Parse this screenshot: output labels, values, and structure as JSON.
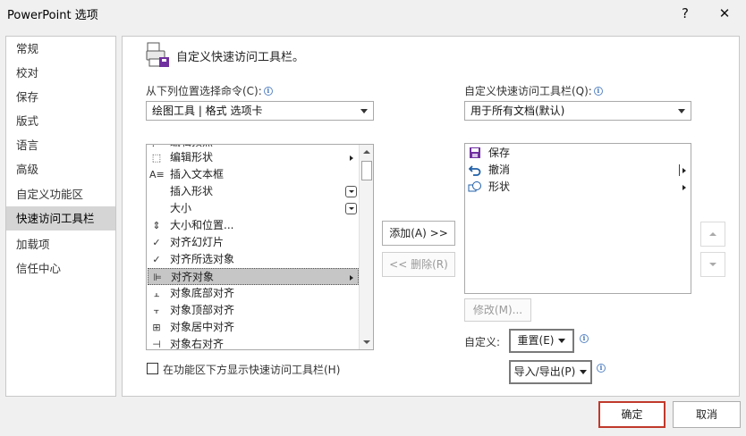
{
  "window": {
    "title": "PowerPoint 选项",
    "help_glyph": "?",
    "close_glyph": "✕"
  },
  "nav": {
    "items": [
      {
        "label": "常规"
      },
      {
        "label": "校对"
      },
      {
        "label": "保存"
      },
      {
        "label": "版式"
      },
      {
        "label": "语言"
      },
      {
        "label": "高级"
      },
      {
        "label": "自定义功能区"
      },
      {
        "label": "快速访问工具栏",
        "active": true
      },
      {
        "label": "加载项"
      },
      {
        "label": "信任中心"
      }
    ]
  },
  "header": {
    "title": "自定义快速访问工具栏。",
    "icon": "toolbar-customize-icon"
  },
  "left": {
    "label": "从下列位置选择命令(C):",
    "info_glyph": "i",
    "combo_value": "绘图工具 | 格式 选项卡",
    "commands": [
      {
        "label": "编辑顶点",
        "icon": "edit-points-icon",
        "glyph": "⋰"
      },
      {
        "label": "编辑形状",
        "icon": "edit-shape-icon",
        "glyph": "⬚",
        "submenu": true
      },
      {
        "label": "插入文本框",
        "icon": "text-box-icon",
        "glyph": "A≡"
      },
      {
        "label": "插入形状",
        "icon": "",
        "glyph": "",
        "dropdown": true
      },
      {
        "label": "大小",
        "icon": "",
        "glyph": "",
        "dropdown": true
      },
      {
        "label": "大小和位置...",
        "icon": "size-position-icon",
        "glyph": "⇕"
      },
      {
        "label": "对齐幻灯片",
        "icon": "check-icon",
        "glyph": "✓"
      },
      {
        "label": "对齐所选对象",
        "icon": "check-icon",
        "glyph": "✓"
      },
      {
        "label": "对齐对象",
        "icon": "align-icon",
        "glyph": "⊫",
        "submenu": true,
        "selected": true
      },
      {
        "label": "对象底部对齐",
        "icon": "align-bottom-icon",
        "glyph": "⫠"
      },
      {
        "label": "对象顶部对齐",
        "icon": "align-top-icon",
        "glyph": "⫟"
      },
      {
        "label": "对象居中对齐",
        "icon": "align-center-icon",
        "glyph": "⊞"
      },
      {
        "label": "对象右对齐",
        "icon": "align-right-icon",
        "glyph": "⊣"
      }
    ]
  },
  "middle": {
    "add_label": "添加(A) >>",
    "add_key": "A",
    "remove_label": "<< 删除(R)",
    "remove_key": "R"
  },
  "right": {
    "label": "自定义快速访问工具栏(Q):",
    "info_glyph": "i",
    "combo_value": "用于所有文档(默认)",
    "items": [
      {
        "label": "保存",
        "icon": "save-icon"
      },
      {
        "label": "撤消",
        "icon": "undo-icon",
        "split": true
      },
      {
        "label": "形状",
        "icon": "shapes-icon",
        "submenu": true
      }
    ],
    "modify_label": "修改(M)...",
    "customize_label": "自定义:",
    "reset_label": "重置(E)",
    "import_export_label": "导入/导出(P)"
  },
  "bottom": {
    "checkbox_label": "在功能区下方显示快速访问工具栏(H)",
    "checkbox_checked": false
  },
  "footer": {
    "ok_label": "确定",
    "cancel_label": "取消"
  },
  "colors": {
    "accent_border": "#c0392b",
    "save_purple": "#7030a0",
    "undo_blue": "#1f5fa8"
  }
}
